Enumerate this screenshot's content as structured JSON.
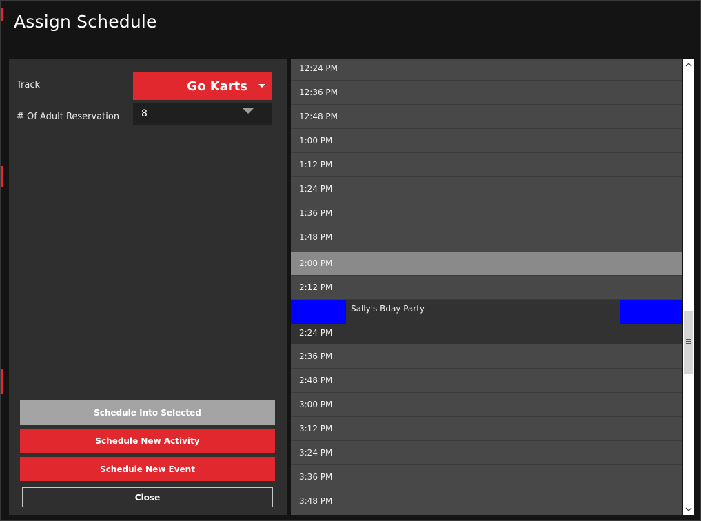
{
  "window": {
    "title": "Assign Schedule"
  },
  "form": {
    "track_label": "Track",
    "track_value": "Go Karts",
    "adult_label": "# Of Adult Reservation",
    "adult_value": "8"
  },
  "buttons": {
    "schedule_into_selected": "Schedule Into Selected",
    "schedule_new_activity": "Schedule New Activity",
    "schedule_new_event": "Schedule New Event",
    "close": "Close"
  },
  "schedule": {
    "slots_before": [
      "12:24 PM",
      "12:36 PM",
      "12:48 PM",
      "1:00 PM",
      "1:12 PM",
      "1:24 PM",
      "1:36 PM",
      "1:48 PM",
      "2:00 PM",
      "2:12 PM"
    ],
    "selected_slot": "2:00 PM",
    "event": {
      "name": "Sally's Bday Party",
      "time": "2:24 PM"
    },
    "slots_after": [
      "2:36 PM",
      "2:48 PM",
      "3:00 PM",
      "3:12 PM",
      "3:24 PM",
      "3:36 PM",
      "3:48 PM"
    ]
  },
  "colors": {
    "accent_red": "#e0282e",
    "event_blue": "#0000ff",
    "selected_grey": "#8a8a8a"
  },
  "icons": {
    "dropdown": "caret-down-icon",
    "spinner": "spinner-down-icon",
    "scroll_up": "chevron-up-icon",
    "scroll_down": "chevron-down-icon"
  }
}
